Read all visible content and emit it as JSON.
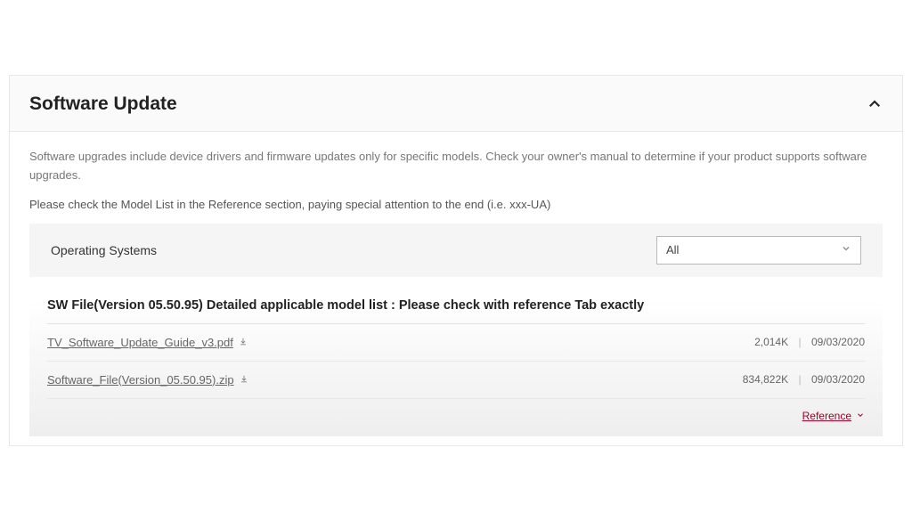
{
  "panel": {
    "title": "Software Update",
    "description": "Software upgrades include device drivers and firmware updates only for specific models. Check your owner's manual to determine if your product supports software upgrades.",
    "note": "Please check the Model List in the Reference section, paying special attention to the end (i.e. xxx-UA)"
  },
  "os": {
    "label": "Operating Systems",
    "selected": "All"
  },
  "sw": {
    "header": "SW File(Version 05.50.95) Detailed applicable model list : Please check with reference Tab exactly",
    "files": [
      {
        "name": "TV_Software_Update_Guide_v3.pdf",
        "size": "2,014K",
        "date": "09/03/2020"
      },
      {
        "name": "Software_File(Version_05.50.95).zip",
        "size": "834,822K",
        "date": "09/03/2020"
      }
    ]
  },
  "reference": {
    "label": "Reference"
  }
}
